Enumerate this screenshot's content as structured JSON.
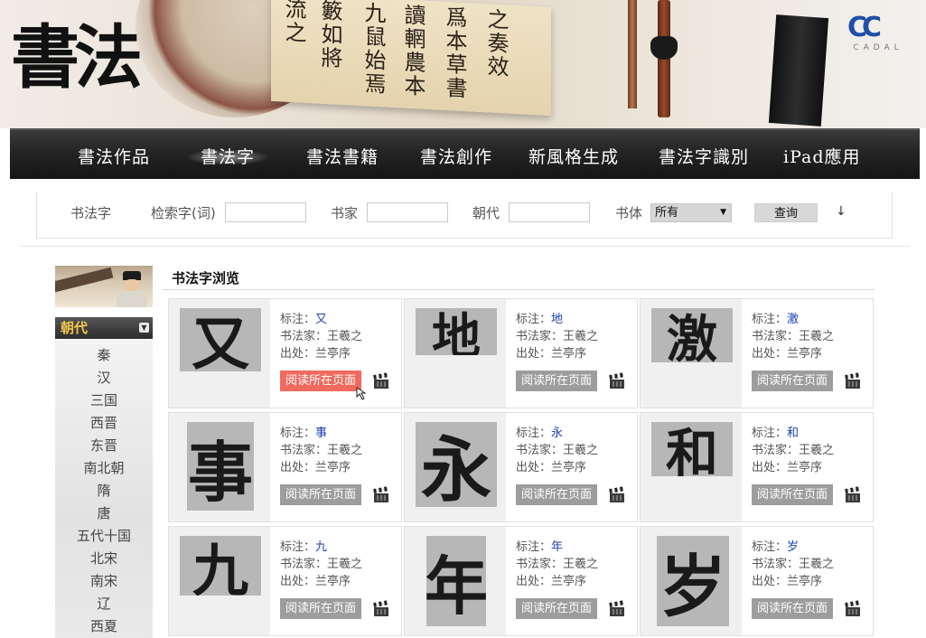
{
  "banner": {
    "logo_text": "書法",
    "brand_mark": "CC",
    "brand_name": "CADAL",
    "scroll_columns": [
      "流之",
      "籔如將",
      "九鼠始焉",
      "讀輞農本",
      "爲本草書",
      "之奏效"
    ]
  },
  "nav": {
    "items": [
      {
        "label": "書法作品",
        "active": false
      },
      {
        "label": "書法字",
        "active": true
      },
      {
        "label": "書法書籍",
        "active": false
      },
      {
        "label": "書法創作",
        "active": false
      },
      {
        "label": "新風格生成",
        "active": false
      },
      {
        "label": "書法字識別",
        "active": false
      },
      {
        "label": "iPad應用",
        "active": false
      }
    ]
  },
  "search": {
    "section_label": "书法字",
    "keyword_label": "检索字(词)",
    "keyword_value": "",
    "author_label": "书家",
    "author_value": "",
    "dynasty_label": "朝代",
    "dynasty_value": "",
    "style_label": "书体",
    "style_selected": "所有",
    "button_label": "查询",
    "sort_arrow": "↓"
  },
  "sidebar": {
    "header": "朝代",
    "dynasties": [
      "秦",
      "汉",
      "三国",
      "西晋",
      "东晋",
      "南北朝",
      "隋",
      "唐",
      "五代十国",
      "北宋",
      "南宋",
      "辽",
      "西夏"
    ]
  },
  "main": {
    "title": "书法字浏览",
    "annotation_label": "标注：",
    "author_label": "书法家：",
    "source_label": "出处：",
    "read_button": "阅读所在页面",
    "cards": [
      {
        "char": "又",
        "author": "王羲之",
        "source": "兰亭序",
        "highlight": true
      },
      {
        "char": "地",
        "author": "王羲之",
        "source": "兰亭序",
        "highlight": false
      },
      {
        "char": "激",
        "author": "王羲之",
        "source": "兰亭序",
        "highlight": false
      },
      {
        "char": "事",
        "author": "王羲之",
        "source": "兰亭序",
        "highlight": false
      },
      {
        "char": "永",
        "author": "王羲之",
        "source": "兰亭序",
        "highlight": false
      },
      {
        "char": "和",
        "author": "王羲之",
        "source": "兰亭序",
        "highlight": false
      },
      {
        "char": "九",
        "author": "王羲之",
        "source": "兰亭序",
        "highlight": false
      },
      {
        "char": "年",
        "author": "王羲之",
        "source": "兰亭序",
        "highlight": false
      },
      {
        "char": "岁",
        "author": "王羲之",
        "source": "兰亭序",
        "highlight": false
      }
    ]
  }
}
